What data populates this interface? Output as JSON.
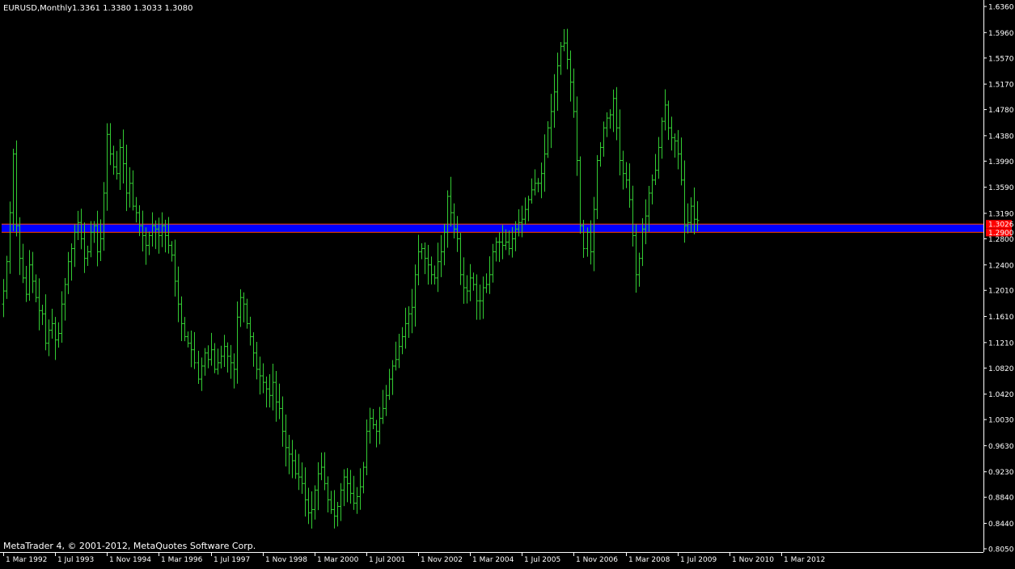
{
  "header": {
    "symbol": "EURUSD,Monthly",
    "ohlc": "1.3361 1.3380 1.3033 1.3080"
  },
  "footer": {
    "copyright": "MetaTrader 4, © 2001-2012, MetaQuotes Software Corp."
  },
  "colors": {
    "background": "#000000",
    "bars": "#33cc33",
    "axis": "#ffffff",
    "zone_fill": "#0000ff",
    "zone_border": "#ff4500",
    "price_label_bg": "#ff0000"
  },
  "chart_data": {
    "type": "ohlc",
    "timeframe": "Monthly",
    "ylim": [
      0.805,
      1.636
    ],
    "xlim": [
      "1992-03",
      "2012-03"
    ],
    "y_ticks": [
      "1.6360",
      "1.5960",
      "1.5570",
      "1.5170",
      "1.4780",
      "1.4380",
      "1.3990",
      "1.3590",
      "1.3190",
      "1.2800",
      "1.2400",
      "1.2010",
      "1.1610",
      "1.1210",
      "1.0820",
      "1.0420",
      "1.0030",
      "0.9630",
      "0.9230",
      "0.8840",
      "0.8440",
      "0.8050"
    ],
    "x_ticks": [
      {
        "label": "1 Mar 1992",
        "date": "1992-03"
      },
      {
        "label": "1 Jul 1993",
        "date": "1993-07"
      },
      {
        "label": "1 Nov 1994",
        "date": "1994-11"
      },
      {
        "label": "1 Mar 1996",
        "date": "1996-03"
      },
      {
        "label": "1 Jul 1997",
        "date": "1997-07"
      },
      {
        "label": "1 Nov 1998",
        "date": "1998-11"
      },
      {
        "label": "1 Mar 2000",
        "date": "2000-03"
      },
      {
        "label": "1 Jul 2001",
        "date": "2001-07"
      },
      {
        "label": "1 Nov 2002",
        "date": "2002-11"
      },
      {
        "label": "1 Mar 2004",
        "date": "2004-03"
      },
      {
        "label": "1 Jul 2005",
        "date": "2005-07"
      },
      {
        "label": "1 Nov 2006",
        "date": "2006-11"
      },
      {
        "label": "1 Mar 2008",
        "date": "2008-03"
      },
      {
        "label": "1 Jul 2009",
        "date": "2009-07"
      },
      {
        "label": "1 Nov 2010",
        "date": "2010-11"
      },
      {
        "label": "1 Mar 2012",
        "date": "2012-03"
      }
    ],
    "zone": {
      "upper": 1.3026,
      "lower": 1.29
    },
    "price_labels": [
      "1.3026",
      "1.2900"
    ],
    "closes": [
      1.2,
      1.245,
      1.32,
      1.41,
      1.3,
      1.25,
      1.22,
      1.195,
      1.24,
      1.215,
      1.19,
      1.17,
      1.165,
      1.12,
      1.14,
      1.15,
      1.125,
      1.135,
      1.18,
      1.21,
      1.245,
      1.265,
      1.29,
      1.305,
      1.28,
      1.25,
      1.26,
      1.29,
      1.3,
      1.26,
      1.28,
      1.35,
      1.44,
      1.41,
      1.39,
      1.38,
      1.42,
      1.395,
      1.35,
      1.365,
      1.33,
      1.32,
      1.3,
      1.285,
      1.27,
      1.285,
      1.3,
      1.295,
      1.285,
      1.3,
      1.285,
      1.27,
      1.255,
      1.215,
      1.18,
      1.15,
      1.13,
      1.12,
      1.11,
      1.09,
      1.065,
      1.085,
      1.105,
      1.095,
      1.11,
      1.08,
      1.09,
      1.1,
      1.115,
      1.1,
      1.09,
      1.08,
      1.16,
      1.19,
      1.18,
      1.15,
      1.13,
      1.105,
      1.08,
      1.07,
      1.06,
      1.05,
      1.04,
      1.06,
      1.03,
      1.02,
      0.985,
      0.96,
      0.95,
      0.94,
      0.92,
      0.915,
      0.905,
      0.88,
      0.86,
      0.865,
      0.895,
      0.92,
      0.93,
      0.905,
      0.88,
      0.865,
      0.855,
      0.87,
      0.895,
      0.915,
      0.905,
      0.89,
      0.875,
      0.885,
      0.9,
      0.93,
      0.985,
      1.005,
      0.995,
      0.985,
      1.005,
      1.02,
      1.04,
      1.065,
      1.085,
      1.095,
      1.115,
      1.13,
      1.15,
      1.165,
      1.175,
      1.225,
      1.26,
      1.265,
      1.25,
      1.24,
      1.225,
      1.22,
      1.245,
      1.26,
      1.29,
      1.345,
      1.32,
      1.295,
      1.28,
      1.225,
      1.205,
      1.2,
      1.22,
      1.21,
      1.185,
      1.185,
      1.205,
      1.21,
      1.225,
      1.26,
      1.275,
      1.275,
      1.27,
      1.275,
      1.265,
      1.28,
      1.295,
      1.305,
      1.31,
      1.325,
      1.34,
      1.355,
      1.365,
      1.365,
      1.38,
      1.41,
      1.45,
      1.475,
      1.505,
      1.545,
      1.575,
      1.58,
      1.555,
      1.52,
      1.475,
      1.4,
      1.3,
      1.265,
      1.29,
      1.26,
      1.325,
      1.4,
      1.42,
      1.45,
      1.465,
      1.47,
      1.495,
      1.45,
      1.4,
      1.38,
      1.37,
      1.34,
      1.285,
      1.225,
      1.25,
      1.295,
      1.315,
      1.35,
      1.37,
      1.385,
      1.42,
      1.46,
      1.485,
      1.45,
      1.435,
      1.43,
      1.41,
      1.37,
      1.3,
      1.305,
      1.33,
      1.31,
      1.308
    ]
  }
}
